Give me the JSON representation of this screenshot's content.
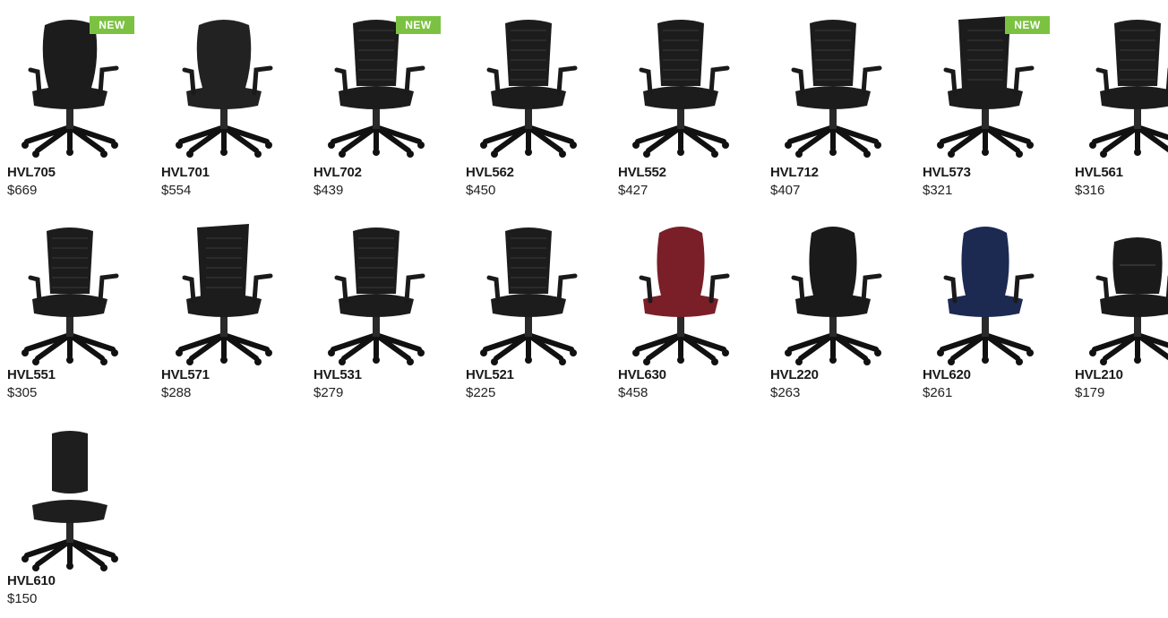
{
  "products": [
    {
      "model": "HVL705",
      "price": "$669",
      "badge": "NEW",
      "style": "contour",
      "color": "#1c1c1c"
    },
    {
      "model": "HVL701",
      "price": "$554",
      "badge": "",
      "style": "contour",
      "color": "#222222"
    },
    {
      "model": "HVL702",
      "price": "$439",
      "badge": "NEW",
      "style": "mesh",
      "color": "#1c1c1c"
    },
    {
      "model": "HVL562",
      "price": "$450",
      "badge": "",
      "style": "mesh",
      "color": "#1c1c1c"
    },
    {
      "model": "HVL552",
      "price": "$427",
      "badge": "",
      "style": "mesh",
      "color": "#1c1c1c"
    },
    {
      "model": "HVL712",
      "price": "$407",
      "badge": "",
      "style": "mesh",
      "color": "#1c1c1c"
    },
    {
      "model": "HVL573",
      "price": "$321",
      "badge": "NEW",
      "style": "tall",
      "color": "#1c1c1c"
    },
    {
      "model": "HVL561",
      "price": "$316",
      "badge": "",
      "style": "mesh",
      "color": "#1c1c1c"
    },
    {
      "model": "HVL551",
      "price": "$305",
      "badge": "",
      "style": "mesh",
      "color": "#1c1c1c"
    },
    {
      "model": "HVL571",
      "price": "$288",
      "badge": "",
      "style": "tall",
      "color": "#1c1c1c"
    },
    {
      "model": "HVL531",
      "price": "$279",
      "badge": "",
      "style": "mesh",
      "color": "#1c1c1c"
    },
    {
      "model": "HVL521",
      "price": "$225",
      "badge": "",
      "style": "mesh",
      "color": "#1c1c1c"
    },
    {
      "model": "HVL630",
      "price": "$458",
      "badge": "",
      "style": "task",
      "color": "#7a1f27"
    },
    {
      "model": "HVL220",
      "price": "$263",
      "badge": "",
      "style": "task",
      "color": "#1a1a1a"
    },
    {
      "model": "HVL620",
      "price": "$261",
      "badge": "",
      "style": "task",
      "color": "#1c2a52"
    },
    {
      "model": "HVL210",
      "price": "$179",
      "badge": "",
      "style": "tufted",
      "color": "#1a1a1a"
    },
    {
      "model": "HVL610",
      "price": "$150",
      "badge": "",
      "style": "armless",
      "color": "#1e1e1e"
    }
  ]
}
